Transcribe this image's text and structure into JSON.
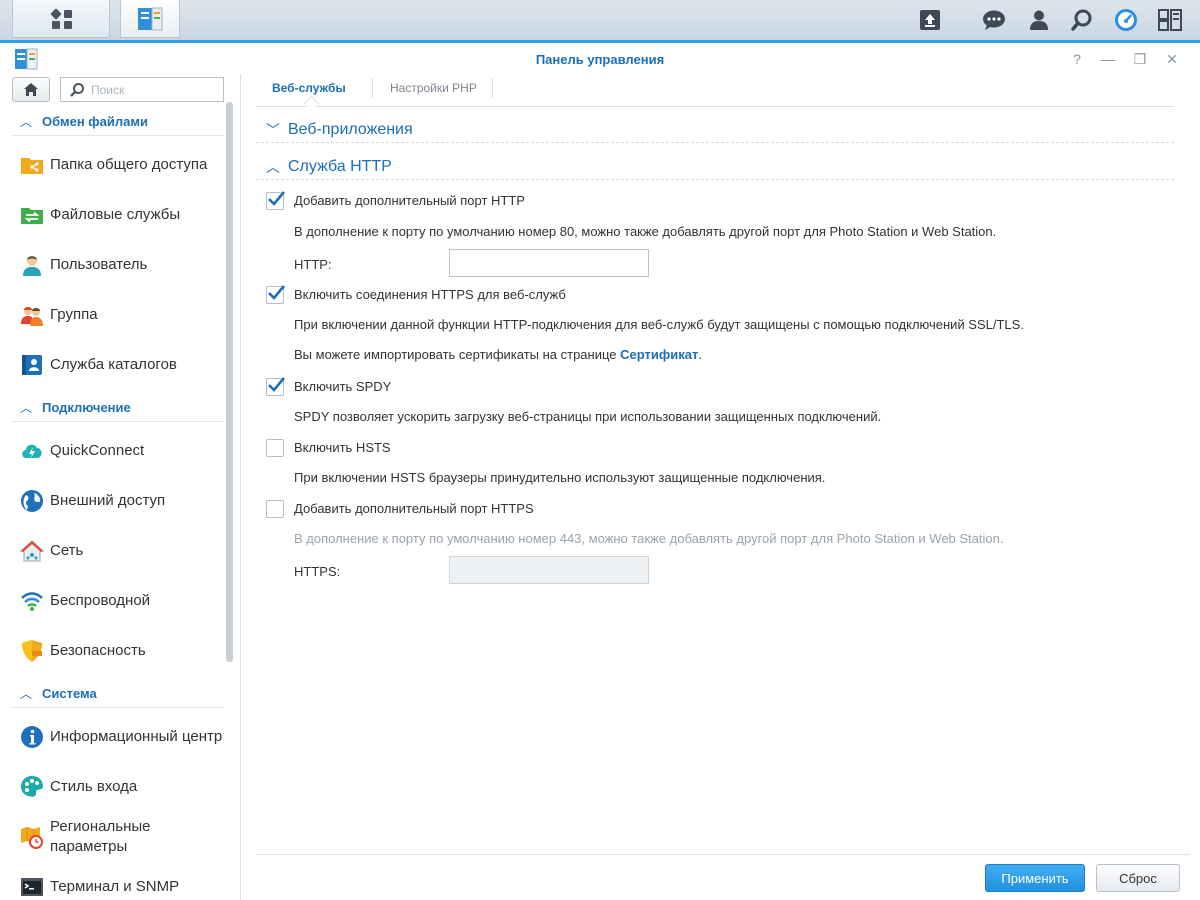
{
  "window": {
    "title": "Панель управления"
  },
  "sidebar": {
    "search_placeholder": "Поиск",
    "sections": [
      {
        "label": "Обмен файлами",
        "items": [
          {
            "label": "Папка общего доступа",
            "icon": "shared-folder-icon"
          },
          {
            "label": "Файловые службы",
            "icon": "file-services-icon"
          },
          {
            "label": "Пользователь",
            "icon": "user-icon"
          },
          {
            "label": "Группа",
            "icon": "group-icon"
          },
          {
            "label": "Служба каталогов",
            "icon": "directory-service-icon"
          }
        ]
      },
      {
        "label": "Подключение",
        "items": [
          {
            "label": "QuickConnect",
            "icon": "quickconnect-icon"
          },
          {
            "label": "Внешний доступ",
            "icon": "globe-icon"
          },
          {
            "label": "Сеть",
            "icon": "network-house-icon"
          },
          {
            "label": "Беспроводной",
            "icon": "wifi-icon"
          },
          {
            "label": "Безопасность",
            "icon": "shield-icon"
          }
        ]
      },
      {
        "label": "Система",
        "items": [
          {
            "label": "Информационный центр",
            "icon": "info-icon"
          },
          {
            "label": "Стиль входа",
            "icon": "palette-icon"
          },
          {
            "label": "Региональные параметры",
            "icon": "regional-clock-icon"
          },
          {
            "label": "Терминал и SNMP",
            "icon": "terminal-icon"
          }
        ]
      }
    ]
  },
  "tabs": [
    {
      "label": "Веб-службы",
      "active": true
    },
    {
      "label": "Настройки PHP",
      "active": false
    }
  ],
  "sections": {
    "web_apps": "Веб-приложения",
    "http_service": "Служба HTTP"
  },
  "options": {
    "extra_http": {
      "label": "Добавить дополнительный порт HTTP",
      "checked": true,
      "desc": "В дополнение к порту по умолчанию номер 80, можно также добавлять другой порт для Photo Station и Web Station.",
      "field_label": "HTTP:",
      "value": ""
    },
    "https": {
      "label": "Включить соединения HTTPS для веб-служб",
      "checked": true,
      "desc": "При включении данной функции HTTP-подключения для веб-служб будут защищены с помощью подключений SSL/TLS.",
      "desc2_prefix": "Вы можете импортировать сертификаты на странице ",
      "desc2_link": "Сертификат",
      "desc2_suffix": "."
    },
    "spdy": {
      "label": "Включить SPDY",
      "checked": true,
      "desc": "SPDY позволяет ускорить загрузку веб-страницы при использовании защищенных подключений."
    },
    "hsts": {
      "label": "Включить HSTS",
      "checked": false,
      "desc": "При включении HSTS браузеры принудительно используют защищенные подключения."
    },
    "extra_https": {
      "label": "Добавить дополнительный порт HTTPS",
      "checked": false,
      "desc": "В дополнение к порту по умолчанию номер 443, можно также добавлять другой порт для Photo Station и Web Station.",
      "field_label": "HTTPS:",
      "value": ""
    }
  },
  "buttons": {
    "apply": "Применить",
    "reset": "Сброс"
  },
  "colors": {
    "accent": "#1b6fb8",
    "primary_button": "#2b9cea",
    "checkmark": "#1b6fb8"
  }
}
